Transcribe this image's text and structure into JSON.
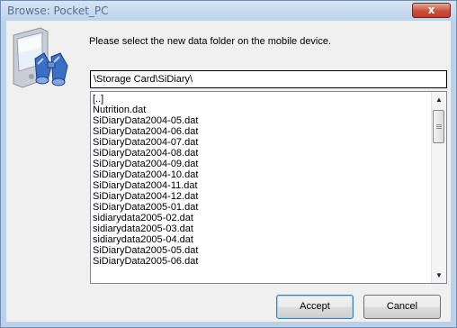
{
  "window": {
    "title": "Browse: Pocket_PC",
    "close_symbol": "x"
  },
  "icons": {
    "device": "pocket-pc-device-icon",
    "search": "binoculars-icon"
  },
  "prompt": "Please select the new data folder on the mobile device.",
  "path": "\\Storage Card\\SiDiary\\",
  "files": [
    "[..]",
    "Nutrition.dat",
    "SiDiaryData2004-05.dat",
    "SiDiaryData2004-06.dat",
    "SiDiaryData2004-07.dat",
    "SiDiaryData2004-08.dat",
    "SiDiaryData2004-09.dat",
    "SiDiaryData2004-10.dat",
    "SiDiaryData2004-11.dat",
    "SiDiaryData2004-12.dat",
    "SiDiaryData2005-01.dat",
    "sidiarydata2005-02.dat",
    "sidiarydata2005-03.dat",
    "sidiarydata2005-04.dat",
    "SiDiaryData2005-05.dat",
    "SiDiaryData2005-06.dat"
  ],
  "buttons": {
    "accept": "Accept",
    "cancel": "Cancel"
  }
}
